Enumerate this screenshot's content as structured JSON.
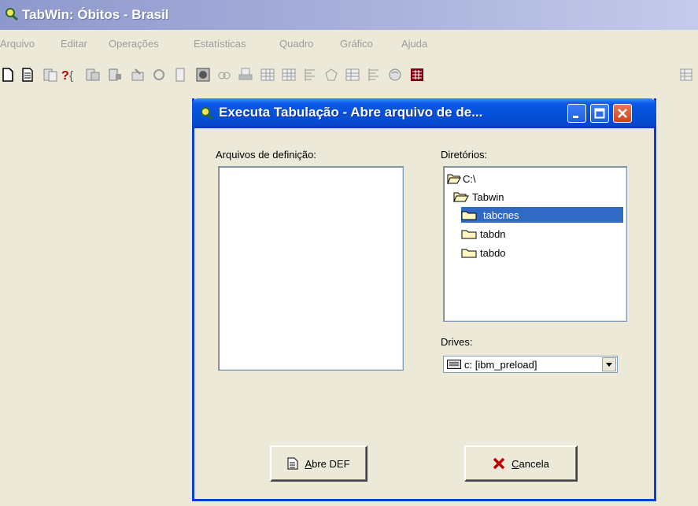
{
  "app": {
    "title": "TabWin:  Óbitos - Brasil"
  },
  "menu": [
    "Arquivo",
    "Editar",
    "Operações",
    "Estatísticas",
    "Quadro",
    "Gráfico",
    "Ajuda"
  ],
  "toolbar": {
    "icons": [
      "new-icon",
      "open-icon",
      "document-icon",
      "help-icon",
      "document-icon",
      "document-icon",
      "table-icon",
      "refresh-icon",
      "page-icon",
      "image-icon",
      "view-icon",
      "print-icon",
      "grid-icon",
      "grid-icon",
      "list-icon",
      "shape-icon",
      "grid-icon",
      "list-icon",
      "globe-icon",
      "calculator-icon",
      "table-icon"
    ]
  },
  "dialog": {
    "title": "Executa Tabulação - Abre arquivo de de...",
    "files_label": "Arquivos de definição:",
    "dirs_label": "Diretórios:",
    "directories": [
      {
        "name": "C:\\",
        "icon": "open-folder-icon",
        "selected": false
      },
      {
        "name": "Tabwin",
        "icon": "open-folder-icon",
        "selected": false
      },
      {
        "name": "tabcnes",
        "icon": "folder-icon",
        "selected": true
      },
      {
        "name": "tabdn",
        "icon": "folder-icon",
        "selected": false
      },
      {
        "name": "tabdo",
        "icon": "folder-icon",
        "selected": false
      }
    ],
    "drives_label": "Drives:",
    "drive_value": "c: [ibm_preload]",
    "open_button": {
      "accel": "A",
      "rest": "bre DEF"
    },
    "cancel_button": {
      "accel": "C",
      "rest": "ancela"
    }
  },
  "colors": {
    "dialog_title": "#0a58e6",
    "selection": "#316ac5",
    "menu_disabled": "#9d9d9d"
  }
}
